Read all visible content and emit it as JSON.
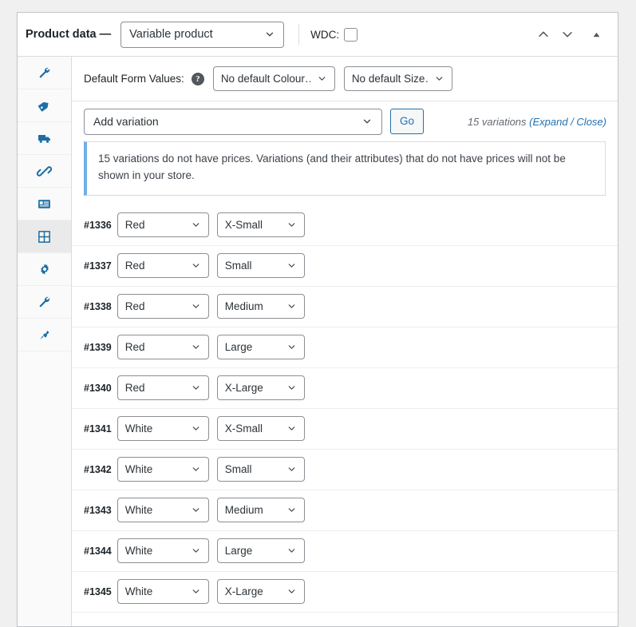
{
  "header": {
    "title": "Product data —",
    "product_type": "Variable product",
    "wdc_label": "WDC:",
    "wdc_checked": false,
    "controls": [
      {
        "name": "move-up-icon",
        "glyph": "chevron-up"
      },
      {
        "name": "move-down-icon",
        "glyph": "chevron-down"
      },
      {
        "name": "toggle-panel-icon",
        "glyph": "triangle-up"
      }
    ]
  },
  "sidebar": {
    "items": [
      {
        "label": "General",
        "icon": "wrench-icon",
        "active": false
      },
      {
        "label": "Inventory",
        "icon": "tag-icon",
        "active": false
      },
      {
        "label": "Shipping",
        "icon": "truck-icon",
        "active": false
      },
      {
        "label": "Linked Products",
        "icon": "link-icon",
        "active": false
      },
      {
        "label": "Attributes",
        "icon": "form-icon",
        "active": false
      },
      {
        "label": "Variations",
        "icon": "grid-icon",
        "active": true
      },
      {
        "label": "Advanced",
        "icon": "gear-icon",
        "active": false
      },
      {
        "label": "Settings",
        "icon": "wrench-icon",
        "active": false
      },
      {
        "label": "Plugins",
        "icon": "plug-icon",
        "active": false
      }
    ]
  },
  "defaults": {
    "label": "Default Form Values:",
    "help_icon": "help-icon",
    "colour_value": "No default Colour…",
    "size_value": "No default Size…"
  },
  "toolbar": {
    "add_variation_value": "Add variation",
    "go_label": "Go",
    "count_text": "15 variations ",
    "expand_label": "(Expand",
    "separator_label": " / ",
    "close_label": "Close)"
  },
  "notice": {
    "message": "15 variations do not have prices. Variations (and their attributes) that do not have prices will not be shown in your store."
  },
  "variations": {
    "rows": [
      {
        "id": "#1336",
        "colour": "Red",
        "size": "X-Small"
      },
      {
        "id": "#1337",
        "colour": "Red",
        "size": "Small"
      },
      {
        "id": "#1338",
        "colour": "Red",
        "size": "Medium"
      },
      {
        "id": "#1339",
        "colour": "Red",
        "size": "Large"
      },
      {
        "id": "#1340",
        "colour": "Red",
        "size": "X-Large"
      },
      {
        "id": "#1341",
        "colour": "White",
        "size": "X-Small"
      },
      {
        "id": "#1342",
        "colour": "White",
        "size": "Small"
      },
      {
        "id": "#1343",
        "colour": "White",
        "size": "Medium"
      },
      {
        "id": "#1344",
        "colour": "White",
        "size": "Large"
      },
      {
        "id": "#1345",
        "colour": "White",
        "size": "X-Large"
      }
    ]
  },
  "colors": {
    "accent": "#2271b1",
    "icon_blue": "#1c6ea4",
    "notice_border": "#72aee6",
    "panel_border": "#c3c4c7"
  }
}
